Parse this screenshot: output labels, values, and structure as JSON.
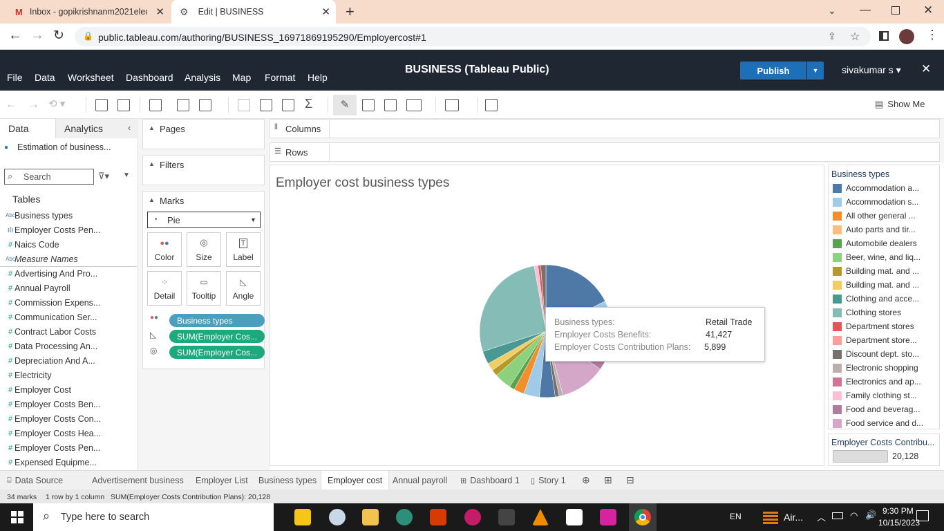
{
  "browser": {
    "tabs": [
      {
        "label": "Inbox - gopikrishnanm2021elect",
        "icon": "gmail-icon"
      },
      {
        "label": "Edit | BUSINESS",
        "icon": "tableau-icon"
      }
    ],
    "url": "public.tableau.com/authoring/BUSINESS_16971869195290/Employercost#1"
  },
  "app": {
    "title": "BUSINESS (Tableau Public)",
    "menu": [
      "File",
      "Data",
      "Worksheet",
      "Dashboard",
      "Analysis",
      "Map",
      "Format",
      "Help"
    ],
    "publish_label": "Publish",
    "user": "sivakumar s",
    "show_me": "Show Me"
  },
  "data_pane": {
    "tabs": [
      "Data",
      "Analytics"
    ],
    "datasource": "Estimation of business...",
    "search_placeholder": "Search",
    "tables_label": "Tables",
    "fields": [
      {
        "name": "Business types",
        "type": "abc"
      },
      {
        "name": "Employer Costs Pen...",
        "type": "bin"
      },
      {
        "name": "Naics Code",
        "type": "num"
      },
      {
        "name": "Measure Names",
        "type": "abc"
      },
      {
        "name": "Advertising And Pro...",
        "type": "num"
      },
      {
        "name": "Annual Payroll",
        "type": "num"
      },
      {
        "name": "Commission Expens...",
        "type": "num"
      },
      {
        "name": "Communication Ser...",
        "type": "num"
      },
      {
        "name": "Contract Labor Costs",
        "type": "num"
      },
      {
        "name": "Data Processing An...",
        "type": "num"
      },
      {
        "name": "Depreciation And A...",
        "type": "num"
      },
      {
        "name": "Electricity",
        "type": "num"
      },
      {
        "name": "Employer Cost",
        "type": "num"
      },
      {
        "name": "Employer Costs Ben...",
        "type": "num"
      },
      {
        "name": "Employer Costs Con...",
        "type": "num"
      },
      {
        "name": "Employer Costs Hea...",
        "type": "num"
      },
      {
        "name": "Employer Costs Pen...",
        "type": "num"
      },
      {
        "name": "Expensed Equipme...",
        "type": "num"
      }
    ]
  },
  "cards": {
    "pages": "Pages",
    "filters": "Filters",
    "marks": "Marks",
    "mark_type": "Pie",
    "mark_buttons": [
      "Color",
      "Size",
      "Label",
      "Detail",
      "Tooltip",
      "Angle"
    ],
    "pills": [
      "Business types",
      "SUM(Employer Cos...",
      "SUM(Employer Cos..."
    ]
  },
  "shelves": {
    "columns": "Columns",
    "rows": "Rows"
  },
  "viz": {
    "title": "Employer cost business types"
  },
  "chart_data": {
    "type": "pie",
    "title": "Employer cost business types",
    "legend_title": "Business types",
    "legend_placement": "right",
    "legend": [
      {
        "name": "Accommodation a...",
        "color": "#4e79a7"
      },
      {
        "name": "Accommodation s...",
        "color": "#a0cbe8"
      },
      {
        "name": "All other general ...",
        "color": "#f28e2b"
      },
      {
        "name": "Auto parts and tir...",
        "color": "#ffbe7d"
      },
      {
        "name": "Automobile dealers",
        "color": "#59a14f"
      },
      {
        "name": "Beer, wine, and liq...",
        "color": "#8cd17d"
      },
      {
        "name": "Building mat. and ...",
        "color": "#b6992d"
      },
      {
        "name": "Building mat. and ...",
        "color": "#f1ce63"
      },
      {
        "name": "Clothing and acce...",
        "color": "#499894"
      },
      {
        "name": "Clothing stores",
        "color": "#86bcb6"
      },
      {
        "name": "Department stores",
        "color": "#e15759"
      },
      {
        "name": "Department store...",
        "color": "#ff9d9a"
      },
      {
        "name": "Discount dept. sto...",
        "color": "#79706e"
      },
      {
        "name": "Electronic shopping",
        "color": "#bab0ac"
      },
      {
        "name": "Electronics and ap...",
        "color": "#d37295"
      },
      {
        "name": "Family clothing st...",
        "color": "#fabfd2"
      },
      {
        "name": "Food and beverag...",
        "color": "#b07aa1"
      },
      {
        "name": "Food service and d...",
        "color": "#d4a6c8"
      }
    ],
    "marks_count": 34,
    "slice_angles_deg": [
      {
        "color": "#4e79a7",
        "deg": 55
      },
      {
        "color": "#a0cbe8",
        "deg": 14
      },
      {
        "color": "#f28e2b",
        "deg": 5
      },
      {
        "color": "#ffbe7d",
        "deg": 4
      },
      {
        "color": "#59a14f",
        "deg": 5
      },
      {
        "color": "#e15759",
        "deg": 6
      },
      {
        "color": "#b07aa1",
        "deg": 20
      },
      {
        "color": "#d4a6c8",
        "deg": 35
      },
      {
        "color": "#bab0ac",
        "deg": 3
      },
      {
        "color": "#79706e",
        "deg": 3
      },
      {
        "color": "#4e79a7",
        "deg": 12
      },
      {
        "color": "#a0cbe8",
        "deg": 12
      },
      {
        "color": "#f28e2b",
        "deg": 8
      },
      {
        "color": "#59a14f",
        "deg": 4
      },
      {
        "color": "#8cd17d",
        "deg": 13
      },
      {
        "color": "#b6992d",
        "deg": 5
      },
      {
        "color": "#f1ce63",
        "deg": 6
      },
      {
        "color": "#499894",
        "deg": 10
      },
      {
        "color": "#86bcb6",
        "deg": 85
      },
      {
        "color": "#fabfd2",
        "deg": 3
      },
      {
        "color": "#e15759",
        "deg": 2
      },
      {
        "color": "#79706e",
        "deg": 4
      }
    ]
  },
  "tooltip": {
    "rows": [
      {
        "key": "Business types:",
        "value": "Retail Trade"
      },
      {
        "key": "Employer Costs Benefits:",
        "value": "41,427"
      },
      {
        "key": "Employer Costs Contribution Plans:",
        "value": "5,899"
      }
    ]
  },
  "size_legend": {
    "title": "Employer Costs Contribu...",
    "value": "20,128"
  },
  "sheets": [
    {
      "label": "Data Source",
      "icon": "database-icon"
    },
    {
      "label": "Advertisement business"
    },
    {
      "label": "Employer List"
    },
    {
      "label": "Business types"
    },
    {
      "label": "Employer cost",
      "active": true
    },
    {
      "label": "Annual payroll"
    },
    {
      "label": "Dashboard 1",
      "icon": "dashboard-icon"
    },
    {
      "label": "Story 1",
      "icon": "story-icon"
    }
  ],
  "status": {
    "marks": "34 marks",
    "dims": "1 row by 1 column",
    "sum": "SUM(Employer Costs Contribution Plans): 20,128"
  },
  "taskbar": {
    "search_placeholder": "Type here to search",
    "lang": "EN",
    "weather": "Air...",
    "time": "9:30 PM",
    "date": "10/15/2023"
  }
}
